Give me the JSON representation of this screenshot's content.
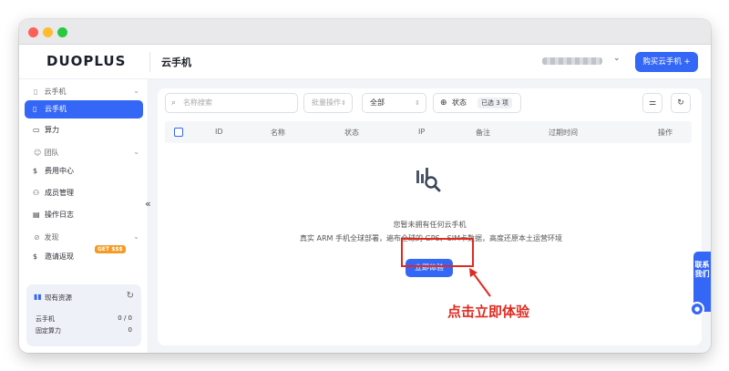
{
  "header": {
    "logo": "DUOPLUS",
    "page_title": "云手机",
    "buy_button": "购买云手机 +",
    "account_chevron": "⌄"
  },
  "sidebar": {
    "group_cloud": "云手机",
    "item_cloud_phone": "云手机",
    "item_compute": "算力",
    "group_team": "团队",
    "item_billing": "费用中心",
    "item_members": "成员管理",
    "item_oplog": "操作日志",
    "group_discover": "发现",
    "item_invite": "邀请返现",
    "invite_badge": "GET $$$",
    "collapse": "«"
  },
  "resources": {
    "title": "现有资源",
    "rows": [
      {
        "label": "云手机",
        "value": "0 / 0"
      },
      {
        "label": "固定算力",
        "value": "0"
      }
    ]
  },
  "toolbar": {
    "search_placeholder": "名称搜索",
    "batch_label": "批量操作",
    "filter_all": "全部",
    "status_label": "状态",
    "status_tag": "已选 3 项"
  },
  "table": {
    "columns": [
      "ID",
      "名称",
      "状态",
      "IP",
      "备注",
      "过期时间",
      "操作"
    ]
  },
  "empty": {
    "title": "您暂未拥有任何云手机",
    "description": "真实 ARM 手机全球部署，遍布全球的 GPS、SIM卡数据，高度还原本土运营环境",
    "button": "立即体验"
  },
  "annotation": {
    "text": "点击立即体验",
    "color": "#e02a20"
  },
  "float": {
    "contact": "联系我们"
  },
  "colors": {
    "accent": "#3467f5",
    "annotation_red": "#e02a20",
    "badge_orange": "#f59a23"
  }
}
